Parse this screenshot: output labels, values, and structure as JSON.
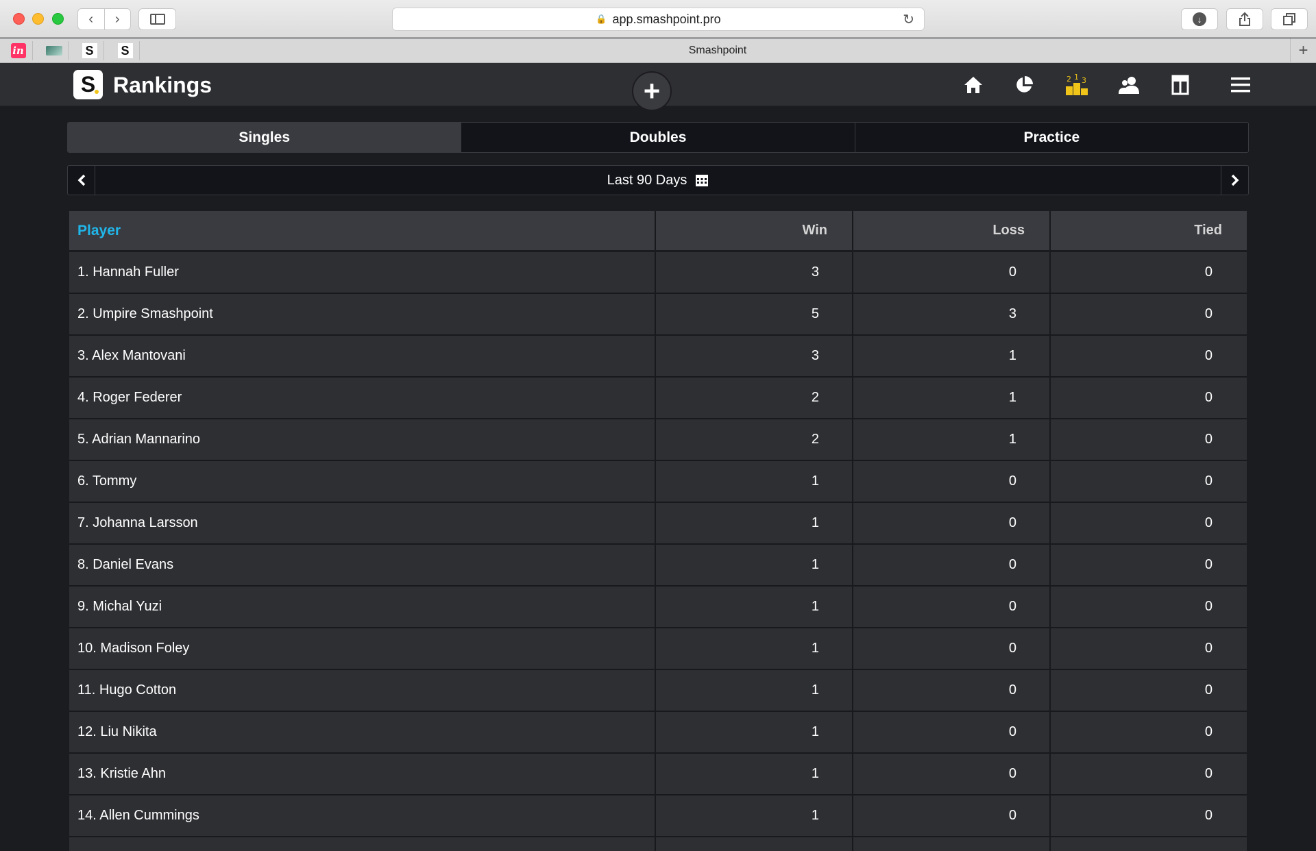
{
  "browser": {
    "url": "app.smashpoint.pro",
    "tab_title": "Smashpoint",
    "nav_back": "‹",
    "nav_forward": "›"
  },
  "app": {
    "title": "Rankings",
    "logo_letter": "S",
    "accent_color": "#21b6ea",
    "active_nav_color": "#f0c419"
  },
  "bookmarks": {
    "invision": "in",
    "smashpoint_1": "S",
    "smashpoint_2": "S"
  },
  "tabs": [
    {
      "label": "Singles",
      "active": true
    },
    {
      "label": "Doubles",
      "active": false
    },
    {
      "label": "Practice",
      "active": false
    }
  ],
  "range": {
    "label": "Last 90 Days"
  },
  "table": {
    "headers": {
      "player": "Player",
      "win": "Win",
      "loss": "Loss",
      "tied": "Tied"
    },
    "rows": [
      {
        "player": "1. Hannah Fuller",
        "win": "3",
        "loss": "0",
        "tied": "0"
      },
      {
        "player": "2. Umpire Smashpoint",
        "win": "5",
        "loss": "3",
        "tied": "0"
      },
      {
        "player": "3. Alex Mantovani",
        "win": "3",
        "loss": "1",
        "tied": "0"
      },
      {
        "player": "4. Roger Federer",
        "win": "2",
        "loss": "1",
        "tied": "0"
      },
      {
        "player": "5. Adrian Mannarino",
        "win": "2",
        "loss": "1",
        "tied": "0"
      },
      {
        "player": "6. Tommy",
        "win": "1",
        "loss": "0",
        "tied": "0"
      },
      {
        "player": "7. Johanna Larsson",
        "win": "1",
        "loss": "0",
        "tied": "0"
      },
      {
        "player": "8. Daniel Evans",
        "win": "1",
        "loss": "0",
        "tied": "0"
      },
      {
        "player": "9. Michal Yuzi",
        "win": "1",
        "loss": "0",
        "tied": "0"
      },
      {
        "player": "10. Madison Foley",
        "win": "1",
        "loss": "0",
        "tied": "0"
      },
      {
        "player": "11. Hugo Cotton",
        "win": "1",
        "loss": "0",
        "tied": "0"
      },
      {
        "player": "12. Liu Nikita",
        "win": "1",
        "loss": "0",
        "tied": "0"
      },
      {
        "player": "13. Kristie Ahn",
        "win": "1",
        "loss": "0",
        "tied": "0"
      },
      {
        "player": "14. Allen Cummings",
        "win": "1",
        "loss": "0",
        "tied": "0"
      },
      {
        "player": "",
        "win": "",
        "loss": "",
        "tied": ""
      }
    ]
  }
}
